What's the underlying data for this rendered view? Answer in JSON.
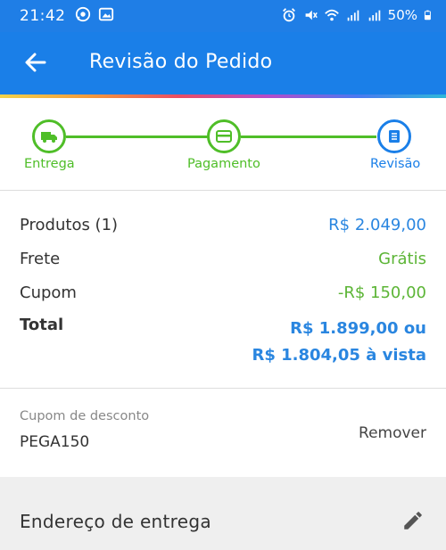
{
  "status_bar": {
    "time": "21:42",
    "battery": "50%",
    "left_icons": [
      "whatsapp-icon",
      "gallery-icon"
    ],
    "right_icons": [
      "alarm-icon",
      "mute-icon",
      "wifi-icon",
      "signal-icon",
      "signal-icon",
      "battery-icon"
    ]
  },
  "app_bar": {
    "title": "Revisão do Pedido",
    "back_icon": "back-arrow-icon"
  },
  "steps": [
    {
      "label": "Entrega",
      "icon": "truck-icon",
      "state": "done"
    },
    {
      "label": "Pagamento",
      "icon": "card-icon",
      "state": "done"
    },
    {
      "label": "Revisão",
      "icon": "document-icon",
      "state": "active"
    }
  ],
  "summary": {
    "products_label": "Produtos (1)",
    "products_value": "R$ 2.049,00",
    "shipping_label": "Frete",
    "shipping_value": "Grátis",
    "coupon_label": "Cupom",
    "coupon_value": "-R$ 150,00",
    "total_label": "Total",
    "total_value_installments": "R$ 1.899,00 ou",
    "total_value_cash": "R$ 1.804,05 à vista"
  },
  "coupon": {
    "caption": "Cupom de desconto",
    "code": "PEGA150",
    "remove_label": "Remover"
  },
  "address": {
    "label": "Endereço de entrega",
    "edit_icon": "pencil-icon"
  },
  "colors": {
    "primary_blue": "#1a7fe8",
    "green": "#4fbe28",
    "price_blue": "#2a86e0"
  }
}
